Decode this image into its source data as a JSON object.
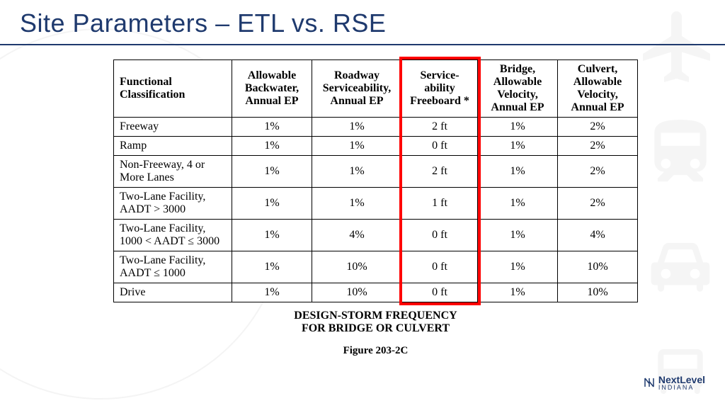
{
  "title": "Site Parameters – ETL vs. RSE",
  "headers": [
    "Functional Classification",
    "Allowable Backwater, Annual EP",
    "Roadway Serviceability, Annual EP",
    "Service-ability Freeboard *",
    "Bridge, Allowable Velocity, Annual EP",
    "Culvert, Allowable Velocity, Annual EP"
  ],
  "rows": [
    {
      "fc": "Freeway",
      "c": [
        "1%",
        "1%",
        "2 ft",
        "1%",
        "2%"
      ]
    },
    {
      "fc": "Ramp",
      "c": [
        "1%",
        "1%",
        "0 ft",
        "1%",
        "2%"
      ]
    },
    {
      "fc": "Non-Freeway, 4 or More Lanes",
      "c": [
        "1%",
        "1%",
        "2 ft",
        "1%",
        "2%"
      ]
    },
    {
      "fc": "Two-Lane Facility, AADT > 3000",
      "c": [
        "1%",
        "1%",
        "1 ft",
        "1%",
        "2%"
      ]
    },
    {
      "fc": "Two-Lane Facility, 1000 < AADT ≤ 3000",
      "c": [
        "1%",
        "4%",
        "0 ft",
        "1%",
        "4%"
      ]
    },
    {
      "fc": "Two-Lane Facility, AADT ≤ 1000",
      "c": [
        "1%",
        "10%",
        "0 ft",
        "1%",
        "10%"
      ]
    },
    {
      "fc": "Drive",
      "c": [
        "1%",
        "10%",
        "0 ft",
        "1%",
        "10%"
      ]
    }
  ],
  "caption_line1": "DESIGN-STORM FREQUENCY",
  "caption_line2": "FOR BRIDGE OR CULVERT",
  "figure_label": "Figure 203-2C",
  "logo_text": "NextLevel",
  "logo_sub": "INDIANA"
}
